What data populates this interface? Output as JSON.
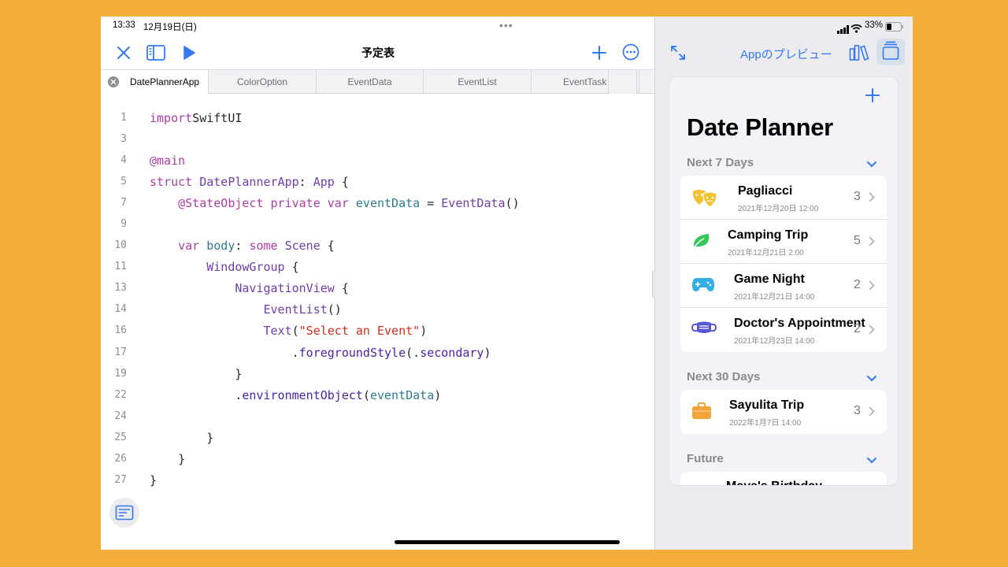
{
  "status": {
    "time": "13:33",
    "date": "12月19日(日)",
    "battery": "33%"
  },
  "toolbar": {
    "title": "予定表",
    "dots": "•••"
  },
  "tabs": [
    "DatePlannerApp",
    "ColorOption",
    "EventData",
    "EventList",
    "EventTask"
  ],
  "code_lines": [
    {
      "n": "1",
      "tokens": [
        [
          "kw",
          "import"
        ],
        [
          "",
          "SwiftUI"
        ]
      ]
    },
    {
      "n": "3",
      "tokens": []
    },
    {
      "n": "4",
      "tokens": [
        [
          "kw",
          "@main"
        ]
      ]
    },
    {
      "n": "5",
      "tokens": [
        [
          "kw",
          "struct"
        ],
        [
          "",
          " "
        ],
        [
          "ty",
          "DatePlannerApp"
        ],
        [
          "",
          ": "
        ],
        [
          "ty",
          "App"
        ],
        [
          "",
          " {"
        ]
      ]
    },
    {
      "n": "7",
      "tokens": [
        [
          "",
          "    "
        ],
        [
          "kw",
          "@StateObject private var"
        ],
        [
          "",
          " "
        ],
        [
          "vr",
          "eventData"
        ],
        [
          "",
          " = "
        ],
        [
          "ty",
          "EventData"
        ],
        [
          "",
          "()"
        ]
      ]
    },
    {
      "n": "9",
      "tokens": []
    },
    {
      "n": "10",
      "tokens": [
        [
          "",
          "    "
        ],
        [
          "kw",
          "var"
        ],
        [
          "",
          " "
        ],
        [
          "vr",
          "body"
        ],
        [
          "",
          ": "
        ],
        [
          "kw",
          "some"
        ],
        [
          "",
          " "
        ],
        [
          "ty",
          "Scene"
        ],
        [
          "",
          " {"
        ]
      ]
    },
    {
      "n": "11",
      "tokens": [
        [
          "",
          "        "
        ],
        [
          "ty",
          "WindowGroup"
        ],
        [
          "",
          " {"
        ]
      ]
    },
    {
      "n": "13",
      "tokens": [
        [
          "",
          "            "
        ],
        [
          "ty",
          "NavigationView"
        ],
        [
          "",
          " {"
        ]
      ]
    },
    {
      "n": "14",
      "tokens": [
        [
          "",
          "                "
        ],
        [
          "ty",
          "EventList"
        ],
        [
          "",
          "()"
        ]
      ]
    },
    {
      "n": "16",
      "tokens": [
        [
          "",
          "                "
        ],
        [
          "ty",
          "Text"
        ],
        [
          "",
          "("
        ],
        [
          "st",
          "\"Select an Event\""
        ],
        [
          "",
          ")"
        ]
      ]
    },
    {
      "n": "17",
      "tokens": [
        [
          "",
          "                    ."
        ],
        [
          "pr",
          "foregroundStyle"
        ],
        [
          "",
          "(."
        ],
        [
          "pr",
          "secondary"
        ],
        [
          "",
          ")"
        ]
      ]
    },
    {
      "n": "19",
      "tokens": [
        [
          "",
          "            }"
        ]
      ]
    },
    {
      "n": "22",
      "tokens": [
        [
          "",
          "            ."
        ],
        [
          "pr",
          "environmentObject"
        ],
        [
          "",
          "("
        ],
        [
          "vr",
          "eventData"
        ],
        [
          "",
          ")"
        ]
      ]
    },
    {
      "n": "24",
      "tokens": []
    },
    {
      "n": "25",
      "tokens": [
        [
          "",
          "        }"
        ]
      ]
    },
    {
      "n": "26",
      "tokens": [
        [
          "",
          "    }"
        ]
      ]
    },
    {
      "n": "27",
      "tokens": [
        [
          "",
          "}"
        ]
      ]
    }
  ],
  "preview": {
    "title": "Appのプレビュー",
    "app_title": "Date Planner",
    "sections": [
      {
        "header": "Next 7 Days",
        "rows": [
          {
            "title": "Pagliacci",
            "date": "2021年12月20日 12:00",
            "count": "3",
            "icon": "theater-masks-icon",
            "color": "#F2C230"
          },
          {
            "title": "Camping Trip",
            "date": "2021年12月21日 2:00",
            "count": "5",
            "icon": "leaf-icon",
            "color": "#34C759"
          },
          {
            "title": "Game Night",
            "date": "2021年12月21日 14:00",
            "count": "2",
            "icon": "gamecontroller-icon",
            "color": "#32ADE6"
          },
          {
            "title": "Doctor's Appointment",
            "date": "2021年12月23日 14:00",
            "count": "2",
            "icon": "medical-mask-icon",
            "color": "#5856D6"
          }
        ]
      },
      {
        "header": "Next 30 Days",
        "rows": [
          {
            "title": "Sayulita Trip",
            "date": "2022年1月7日 14:00",
            "count": "3",
            "icon": "suitcase-icon",
            "color": "#F2A33A"
          }
        ]
      },
      {
        "header": "Future",
        "rows": [
          {
            "title": "Maya's Birthday",
            "date": "",
            "count": "",
            "icon": "",
            "color": ""
          }
        ]
      }
    ]
  },
  "colors": {
    "accent": "#3478F6",
    "background": "#F2AE38"
  }
}
